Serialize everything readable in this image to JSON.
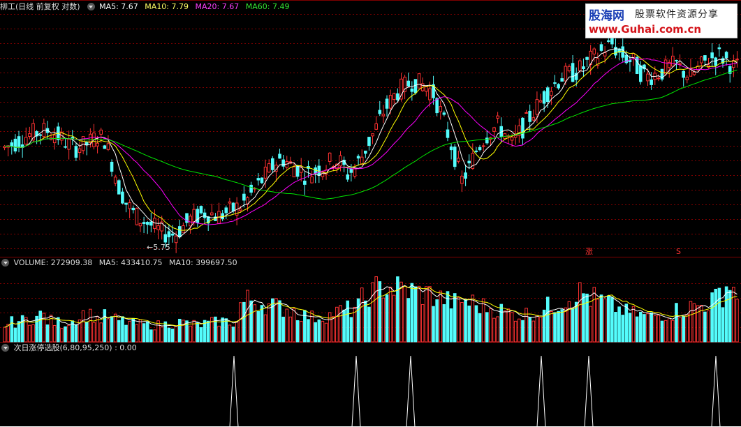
{
  "header_price": {
    "title": "柳工(日线 前复权 对数)",
    "ma5": "MA5: 7.67",
    "ma10": "MA10: 7.79",
    "ma20": "MA20: 7.67",
    "ma60": "MA60: 7.49"
  },
  "header_volume": {
    "title": "VOLUME: 272909.38",
    "ma5": "MA5: 433410.75",
    "ma10": "MA10: 399697.50"
  },
  "header_indicator": {
    "title": "次日涨停选股(6,80,95,250)",
    "value": ": 0.00"
  },
  "annotations": {
    "low_price": "5.75",
    "mark_zhang": "涨",
    "mark_s": "S"
  },
  "watermark": {
    "line1_cn": "股海网",
    "line1_sub": "股票软件资源分享",
    "line2": "www.Guhai.com.cn"
  },
  "colors": {
    "up": "#ff3232",
    "down": "#54fcfc",
    "ma5": "#ffffff",
    "ma10": "#ffff00",
    "ma20": "#ff00ff",
    "ma60": "#00e600",
    "grid": "#800000",
    "signal": "#ffffff"
  },
  "chart_data": {
    "type": "candlestick",
    "price_mid": [
      7.15,
      7.2,
      7.28,
      7.35,
      7.4,
      7.43,
      7.45,
      7.4,
      7.3,
      7.2,
      7.15,
      7.18,
      7.25,
      7.35,
      7.3,
      6.9,
      6.5,
      6.25,
      6.1,
      6.0,
      5.95,
      5.88,
      5.82,
      5.78,
      5.8,
      5.9,
      6.0,
      6.05,
      6.1,
      6.08,
      6.05,
      6.1,
      6.15,
      6.2,
      6.3,
      6.45,
      6.6,
      6.75,
      6.9,
      6.95,
      6.85,
      6.8,
      6.7,
      6.72,
      6.8,
      6.85,
      6.95,
      6.9,
      6.7,
      6.8,
      7.0,
      7.25,
      7.5,
      7.8,
      8.0,
      8.2,
      8.3,
      8.4,
      8.35,
      8.3,
      8.15,
      7.8,
      7.4,
      7.0,
      6.6,
      6.8,
      7.1,
      7.3,
      7.45,
      7.55,
      7.4,
      7.2,
      7.4,
      7.6,
      7.8,
      8.0,
      8.2,
      8.35,
      8.5,
      8.55,
      8.6,
      8.7,
      8.85,
      8.95,
      9.1,
      9.2,
      9.0,
      8.9,
      8.8,
      8.6,
      8.5,
      8.55,
      8.6,
      8.7,
      8.75,
      8.6,
      8.5,
      8.65,
      8.8,
      8.9,
      8.95,
      8.85,
      8.7
    ],
    "volume": [
      25,
      28,
      30,
      32,
      35,
      38,
      30,
      28,
      26,
      30,
      35,
      40,
      38,
      33,
      36,
      32,
      30,
      28,
      26,
      25,
      24,
      24,
      25,
      26,
      28,
      27,
      25,
      24,
      26,
      28,
      30,
      29,
      27,
      55,
      60,
      58,
      55,
      52,
      50,
      48,
      45,
      40,
      38,
      35,
      36,
      38,
      42,
      44,
      46,
      50,
      60,
      70,
      75,
      80,
      78,
      76,
      74,
      72,
      70,
      68,
      65,
      62,
      58,
      55,
      60,
      56,
      52,
      50,
      48,
      45,
      42,
      40,
      38,
      40,
      42,
      45,
      50,
      55,
      60,
      65,
      70,
      68,
      62,
      58,
      55,
      50,
      46,
      42,
      40,
      38,
      36,
      38,
      40,
      42,
      45,
      48,
      50,
      52,
      55,
      60,
      70,
      80,
      75
    ],
    "signal_x": [
      335,
      510,
      588,
      775,
      843,
      1025
    ],
    "price_range": [
      5.6,
      9.9
    ],
    "low_marker": 5.75
  }
}
